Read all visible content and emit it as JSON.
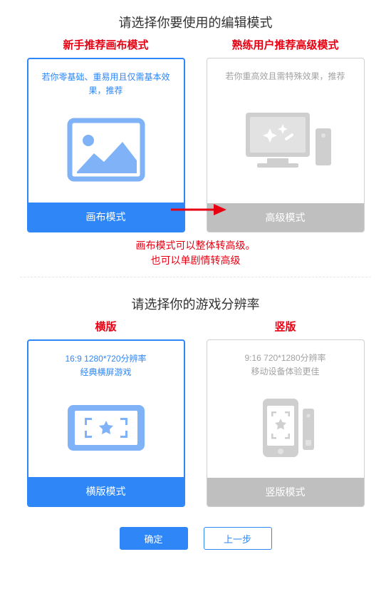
{
  "section1": {
    "title": "请选择你要使用的编辑模式",
    "cards": [
      {
        "label": "新手推荐画布模式",
        "desc": "若你零基础、重易用且仅需基本效果，推荐",
        "footer": "画布模式"
      },
      {
        "label": "熟练用户推荐高级模式",
        "desc": "若你重高效且需特殊效果，推荐",
        "footer": "高级模式"
      }
    ],
    "annotation_line1": "画布模式可以整体转高级。",
    "annotation_line2": "也可以单剧情转高级"
  },
  "section2": {
    "title": "请选择你的游戏分辨率",
    "cards": [
      {
        "label": "横版",
        "desc_line1": "16:9 1280*720分辨率",
        "desc_line2": "经典横屏游戏",
        "footer": "横版模式"
      },
      {
        "label": "竖版",
        "desc_line1": "9:16 720*1280分辨率",
        "desc_line2": "移动设备体验更佳",
        "footer": "竖版模式"
      }
    ]
  },
  "buttons": {
    "confirm": "确定",
    "back": "上一步"
  }
}
